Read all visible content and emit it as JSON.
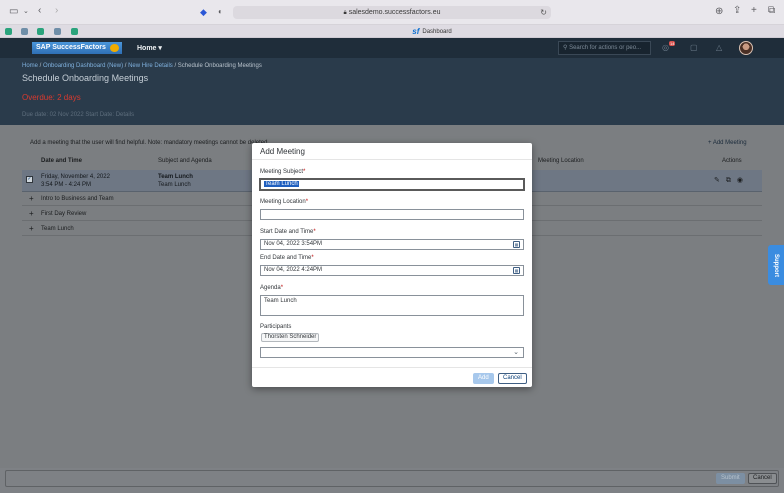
{
  "browser": {
    "url": "salesdemo.successfactors.eu",
    "tab_label": "Dashboard",
    "tab_logo": "sf"
  },
  "shell": {
    "logo_text": "SAP SuccessFactors",
    "home_label": "Home",
    "search_placeholder": "Search for actions or peo...",
    "notification_count": "14"
  },
  "header": {
    "breadcrumb": {
      "home": "Home",
      "onboarding": "Onboarding Dashboard (New)",
      "hire": "New Hire Details",
      "current": "Schedule Onboarding Meetings",
      "sep": " / "
    },
    "page_title": "Schedule Onboarding Meetings",
    "overdue": "Overdue: 2 days",
    "due_line": "Due date: 02 Nov 2022  Start Date:  Details"
  },
  "content": {
    "hint": "Add a meeting that the user will find helpful. Note: mandatory meetings cannot be deleted.",
    "add_meeting": "Add Meeting",
    "columns": {
      "date": "Date and Time",
      "subject": "Subject and Agenda",
      "location": "Meeting Location",
      "actions": "Actions"
    },
    "selected_row": {
      "date_line1": "Friday, November 4, 2022",
      "date_line2": "3:54 PM - 4:24 PM",
      "subject": "Team Lunch",
      "agenda": "Team Lunch"
    },
    "meetings": [
      {
        "label": "Intro to Business and Team"
      },
      {
        "label": "First Day Review"
      },
      {
        "label": "Team Lunch"
      }
    ]
  },
  "footer": {
    "submit": "Submit",
    "cancel": "Cancel"
  },
  "support_tab": "Support",
  "dialog": {
    "title": "Add Meeting",
    "subject_label": "Meeting Subject",
    "subject_value": "Team Lunch",
    "location_label": "Meeting Location",
    "location_value": "",
    "start_label": "Start Date and Time",
    "start_value": "Nov 04, 2022 3:54PM",
    "end_label": "End Date and Time",
    "end_value": "Nov 04, 2022 4:24PM",
    "agenda_label": "Agenda",
    "agenda_value": "Team Lunch",
    "participants_label": "Participants",
    "participant_token": "Thorsten Schneider",
    "required_mark": "*",
    "add_button": "Add",
    "cancel_button": "Cancel"
  },
  "icons": {
    "sidebar": "sidebar-toggle-icon",
    "back": "chevron-left-icon",
    "forward": "chevron-right-icon",
    "shield": "shield-icon",
    "privacy": "privacy-icon",
    "download": "download-icon",
    "share": "share-icon",
    "new_tab": "plus-icon",
    "tabs": "tab-overview-icon",
    "calendar": "calendar-icon",
    "edit": "pencil-icon",
    "copy": "copy-icon",
    "view": "eye-icon"
  },
  "colors": {
    "shell": "#1f2d3a",
    "header": "#2a3b4b",
    "overdue": "#d93a2f",
    "accent": "#0a6ed1",
    "support": "#3a8ce0"
  }
}
